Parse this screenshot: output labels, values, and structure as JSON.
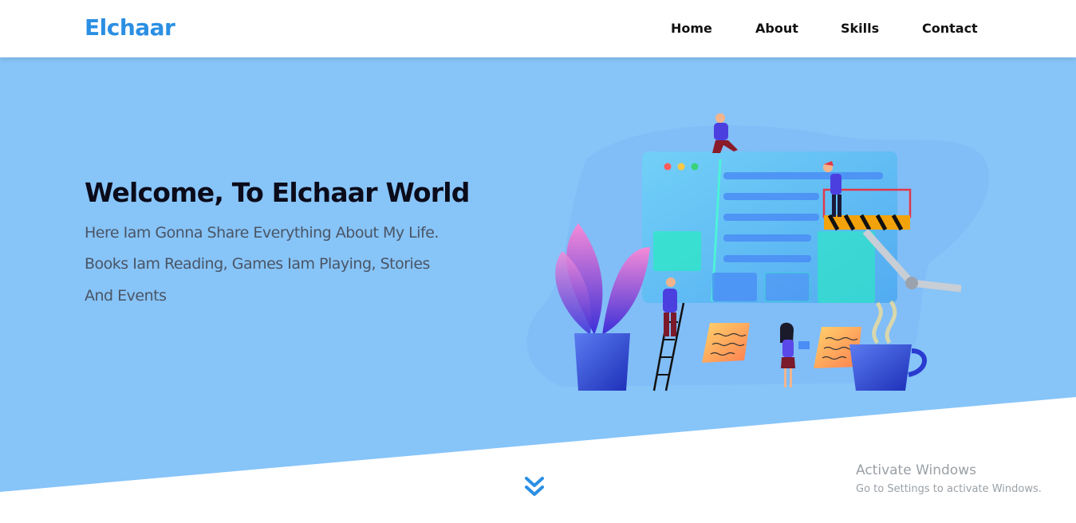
{
  "header": {
    "brand": "Elchaar",
    "nav": [
      {
        "label": "Home"
      },
      {
        "label": "About"
      },
      {
        "label": "Skills"
      },
      {
        "label": "Contact"
      }
    ]
  },
  "hero": {
    "title": "Welcome, To Elchaar World",
    "lines": [
      "Here Iam Gonna Share Everything About My Life.",
      "Books Iam Reading, Games Iam Playing, Stories",
      "And Events"
    ],
    "illustration_icon": "web-development-team-illustration",
    "scroll_icon": "double-chevron-down-icon"
  },
  "watermark": {
    "title": "Activate Windows",
    "subtitle": "Go to Settings to activate Windows."
  },
  "colors": {
    "brand": "#2b8fe3",
    "hero_bg": "#87c4f8",
    "nav_text": "#111111",
    "title_text": "#0b0b1a",
    "body_text": "#4a5565"
  }
}
